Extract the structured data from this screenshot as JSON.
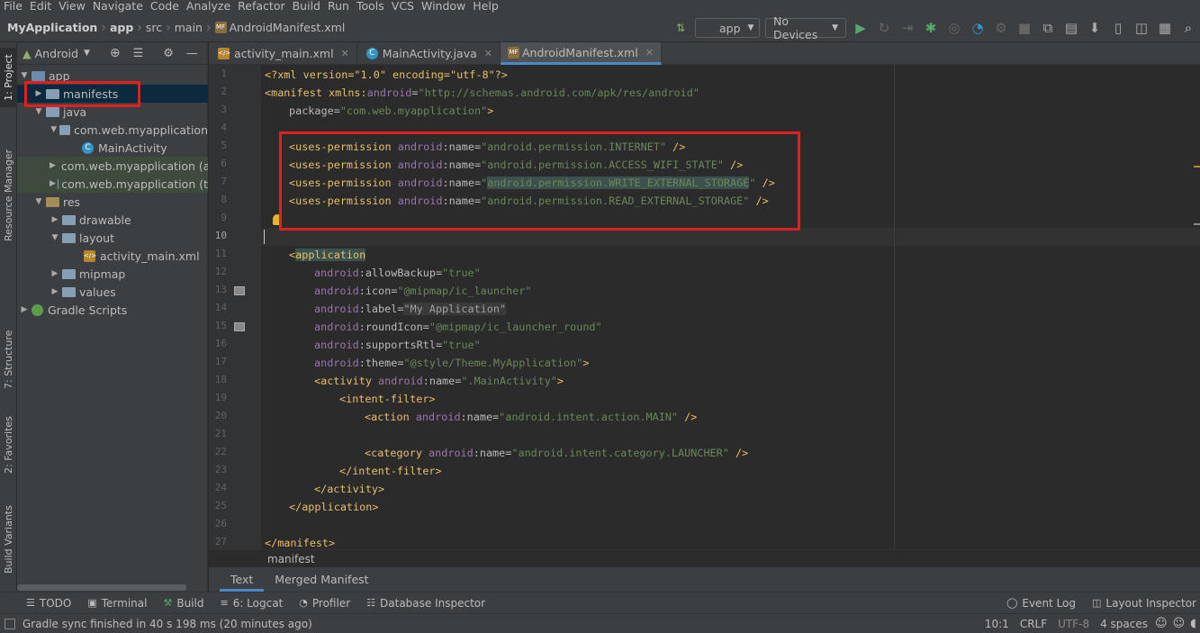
{
  "menu": [
    "File",
    "Edit",
    "View",
    "Navigate",
    "Code",
    "Analyze",
    "Refactor",
    "Build",
    "Run",
    "Tools",
    "VCS",
    "Window",
    "Help"
  ],
  "breadcrumb": {
    "project": "MyApplication",
    "module": "app",
    "src": "src",
    "main": "main",
    "file": "AndroidManifest.xml"
  },
  "toolbar": {
    "config": "app",
    "device": "No Devices"
  },
  "side_tabs": {
    "project": "1: Project",
    "resource": "Resource Manager",
    "structure": "7: Structure",
    "favorites": "2: Favorites",
    "variants": "Build Variants"
  },
  "project_panel": {
    "view": "Android"
  },
  "tree": [
    {
      "label": "app"
    },
    {
      "label": "manifests"
    },
    {
      "label": "java"
    },
    {
      "label": "com.web.myapplication"
    },
    {
      "label": "MainActivity"
    },
    {
      "label": "com.web.myapplication (a"
    },
    {
      "label": "com.web.myapplication (t"
    },
    {
      "label": "res"
    },
    {
      "label": "drawable"
    },
    {
      "label": "layout"
    },
    {
      "label": "activity_main.xml"
    },
    {
      "label": "mipmap"
    },
    {
      "label": "values"
    },
    {
      "label": "Gradle Scripts"
    }
  ],
  "editor_tabs": [
    "activity_main.xml",
    "MainActivity.java",
    "AndroidManifest.xml"
  ],
  "line_numbers": [
    "1",
    "2",
    "3",
    "4",
    "5",
    "6",
    "7",
    "8",
    "9",
    "10",
    "11",
    "12",
    "13",
    "14",
    "15",
    "16",
    "17",
    "18",
    "19",
    "20",
    "21",
    "22",
    "23",
    "24",
    "25",
    "26",
    "27"
  ],
  "code": {
    "l1": "<?xml version=\"1.0\" encoding=\"utf-8\"?>",
    "l2a": "<manifest xmlns:",
    "l2b": "android",
    "l2c": "=",
    "l2d": "\"http://schemas.android.com/apk/res/android\"",
    "l3a": "package=",
    "l3b": "\"com.web.myapplication\"",
    "l3c": ">",
    "perm_tag": "<uses-permission ",
    "perm_ns": "android",
    "perm_attr": ":name=",
    "perm_close": " />",
    "p1": "\"android.permission.INTERNET\"",
    "p2": "\"android.permission.ACCESS_WIFI_STATE\"",
    "p3a": "\"",
    "p3b": "android.permission.WRITE_EXTERNAL_STORAGE",
    "p3c": "\"",
    "p4": "\"android.permission.READ_EXTERNAL_STORAGE\"",
    "app_open": "<",
    "app_name": "application",
    "ns": "android",
    "allowBackup": ":allowBackup=",
    "allowBackup_v": "\"true\"",
    "icon": ":icon=",
    "icon_v": "\"@mipmap/ic_launcher\"",
    "label": ":label=",
    "label_v": "\"My Application\"",
    "roundIcon": ":roundIcon=",
    "roundIcon_v": "\"@mipmap/ic_launcher_round\"",
    "supportsRtl": ":supportsRtl=",
    "supportsRtl_v": "\"true\"",
    "theme": ":theme=",
    "theme_v": "\"@style/Theme.MyApplication\"",
    "theme_close": ">",
    "activity_open": "<activity ",
    "name": ":name=",
    "activity_v": "\".MainActivity\"",
    "gt": ">",
    "intent_open": "<intent-filter>",
    "action_open": "<action ",
    "action_v": "\"android.intent.action.MAIN\"",
    "self_close": " />",
    "category_open": "<category ",
    "category_v": "\"android.intent.category.LAUNCHER\"",
    "intent_close": "</intent-filter>",
    "activity_close": "</activity>",
    "app_close": "</application>",
    "manifest_close": "</manifest>"
  },
  "editor_breadcrumb": "manifest",
  "bottom_tabs": [
    "Text",
    "Merged Manifest"
  ],
  "tool_windows": {
    "todo": "TODO",
    "terminal": "Terminal",
    "build": "Build",
    "logcat": "6: Logcat",
    "profiler": "Profiler",
    "db": "Database Inspector",
    "eventlog": "Event Log",
    "layoutinspector": "Layout Inspector"
  },
  "status": {
    "message": "Gradle sync finished in 40 s 198 ms (20 minutes ago)",
    "position": "10:1",
    "line_sep": "CRLF",
    "encoding": "UTF-8",
    "indent": "4 spaces"
  },
  "colors": {
    "highlight_box": "#e02020",
    "accent": "#4a88c7"
  }
}
